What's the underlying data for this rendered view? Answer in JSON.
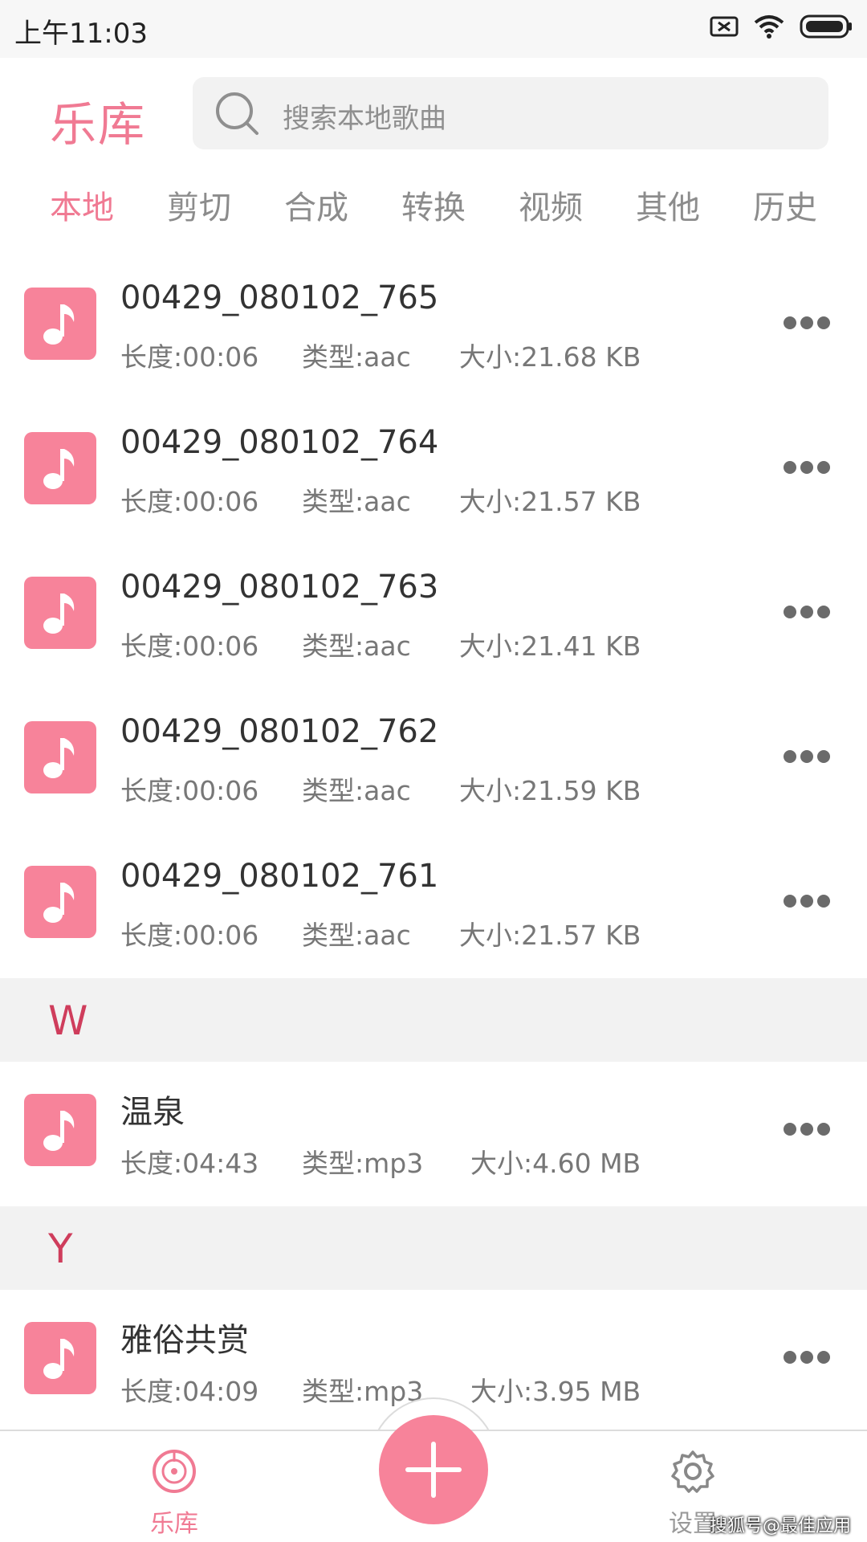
{
  "status_bar": {
    "time": "上午11:03"
  },
  "header": {
    "title": "乐库",
    "search_placeholder": "搜索本地歌曲"
  },
  "tabs": [
    {
      "label": "本地",
      "active": true
    },
    {
      "label": "剪切",
      "active": false
    },
    {
      "label": "合成",
      "active": false
    },
    {
      "label": "转换",
      "active": false
    },
    {
      "label": "视频",
      "active": false
    },
    {
      "label": "其他",
      "active": false
    },
    {
      "label": "历史",
      "active": false
    }
  ],
  "songs": [
    {
      "title": "00429_080102_765",
      "length": "长度:00:06",
      "type": "类型:aac",
      "size": "大小:21.68 KB"
    },
    {
      "title": "00429_080102_764",
      "length": "长度:00:06",
      "type": "类型:aac",
      "size": "大小:21.57 KB"
    },
    {
      "title": "00429_080102_763",
      "length": "长度:00:06",
      "type": "类型:aac",
      "size": "大小:21.41 KB"
    },
    {
      "title": "00429_080102_762",
      "length": "长度:00:06",
      "type": "类型:aac",
      "size": "大小:21.59 KB"
    },
    {
      "title": "00429_080102_761",
      "length": "长度:00:06",
      "type": "类型:aac",
      "size": "大小:21.57 KB"
    }
  ],
  "section_w": {
    "letter": "W",
    "song": {
      "title": "温泉",
      "length": "长度:04:43",
      "type": "类型:mp3",
      "size": "大小:4.60 MB"
    }
  },
  "section_y": {
    "letter": "Y",
    "song": {
      "title": "雅俗共赏",
      "length": "长度:04:09",
      "type": "类型:mp3",
      "size": "大小:3.95 MB"
    }
  },
  "bottom_nav": {
    "library_label": "乐库",
    "settings_label": "设置"
  },
  "watermark": "搜狐号@最佳应用",
  "colors": {
    "accent": "#f07a93",
    "icon_bg": "#f7839a",
    "section_letter": "#cf3d5c"
  },
  "icons": [
    "battery-x-icon",
    "wifi-icon",
    "battery-icon",
    "search-icon",
    "music-note-icon",
    "more-icon",
    "vinyl-icon",
    "plus-icon",
    "gear-icon"
  ]
}
